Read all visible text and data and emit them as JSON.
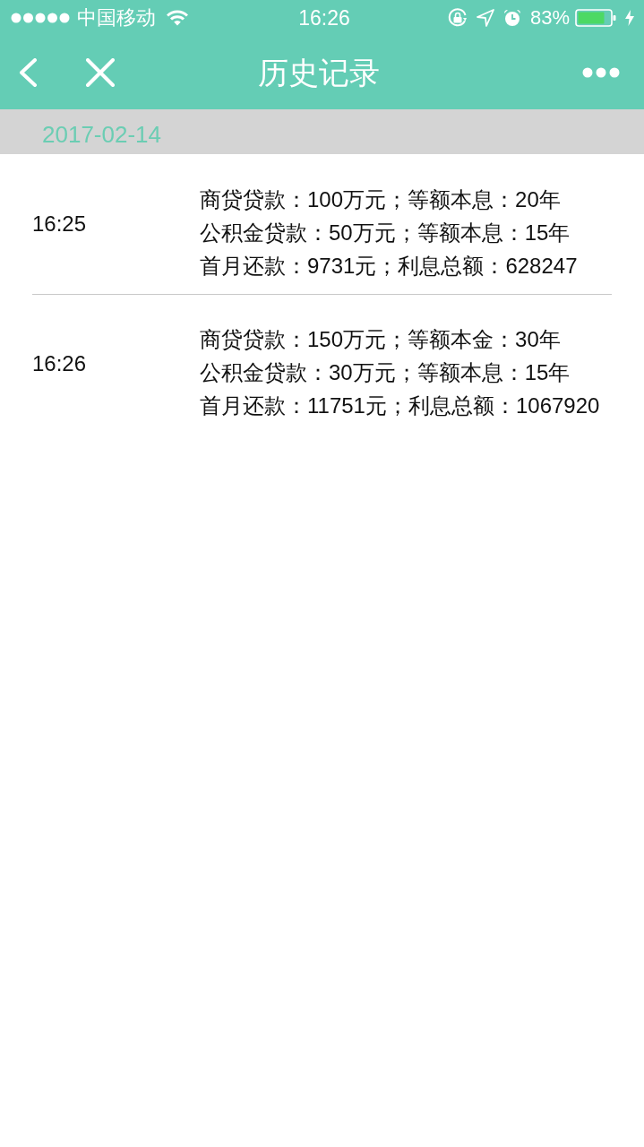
{
  "status_bar": {
    "carrier": "中国移动",
    "time": "16:26",
    "battery": "83%"
  },
  "nav_bar": {
    "title": "历史记录"
  },
  "sections": [
    {
      "date": "2017-02-14",
      "records": [
        {
          "time": "16:25",
          "lines": [
            "商贷贷款：100万元；等额本息：20年",
            "公积金贷款：50万元；等额本息：15年",
            "首月还款：9731元；利息总额：628247"
          ]
        },
        {
          "time": "16:26",
          "lines": [
            "商贷贷款：150万元；等额本金：30年",
            "公积金贷款：30万元；等额本息：15年",
            "首月还款：11751元；利息总额：1067920"
          ]
        }
      ]
    }
  ]
}
